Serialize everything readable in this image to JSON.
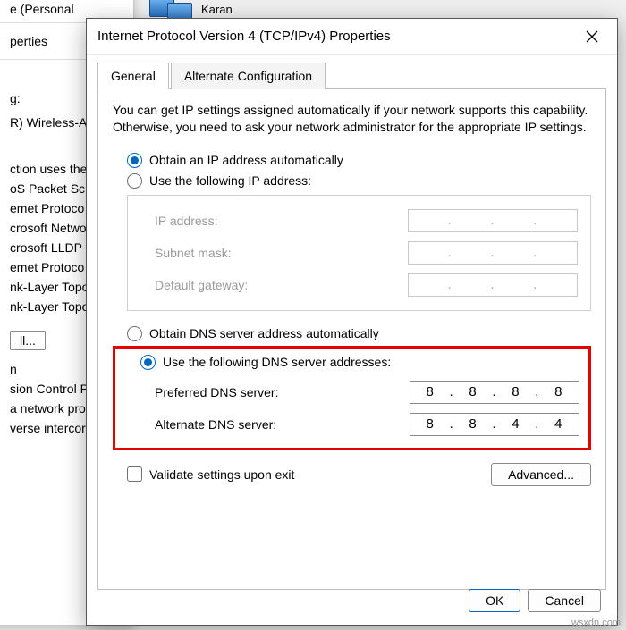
{
  "bg": {
    "adapter_label": "Karan",
    "conn_personal": "e (Personal",
    "properties_header": "perties",
    "connect_using_label": "g:",
    "adapter_name": "R) Wireless-A",
    "desc_label": "ction uses the",
    "items": [
      "oS Packet Sc",
      "emet Protoco",
      "crosoft Netwo",
      "crosoft LLDP",
      "emet Protoco",
      "nk-Layer Topo",
      "nk-Layer Topo"
    ],
    "install_btn": "ll...",
    "footer1": "n",
    "footer2": "sion Control P",
    "footer3": "a network pro",
    "footer4": "verse intercor"
  },
  "dialog": {
    "title": "Internet Protocol Version 4 (TCP/IPv4) Properties",
    "tabs": {
      "general": "General",
      "alternate": "Alternate Configuration"
    },
    "description": "You can get IP settings assigned automatically if your network supports this capability. Otherwise, you need to ask your network administrator for the appropriate IP settings.",
    "ip": {
      "auto": "Obtain an IP address automatically",
      "manual": "Use the following IP address:",
      "ip_label": "IP address:",
      "subnet_label": "Subnet mask:",
      "gateway_label": "Default gateway:"
    },
    "dns": {
      "auto": "Obtain DNS server address automatically",
      "manual": "Use the following DNS server addresses:",
      "preferred_label": "Preferred DNS server:",
      "alternate_label": "Alternate DNS server:",
      "preferred": [
        "8",
        "8",
        "8",
        "8"
      ],
      "alternate": [
        "8",
        "8",
        "4",
        "4"
      ]
    },
    "validate": "Validate settings upon exit",
    "advanced": "Advanced...",
    "ok": "OK",
    "cancel": "Cancel"
  },
  "watermark": "wsxdn.com"
}
